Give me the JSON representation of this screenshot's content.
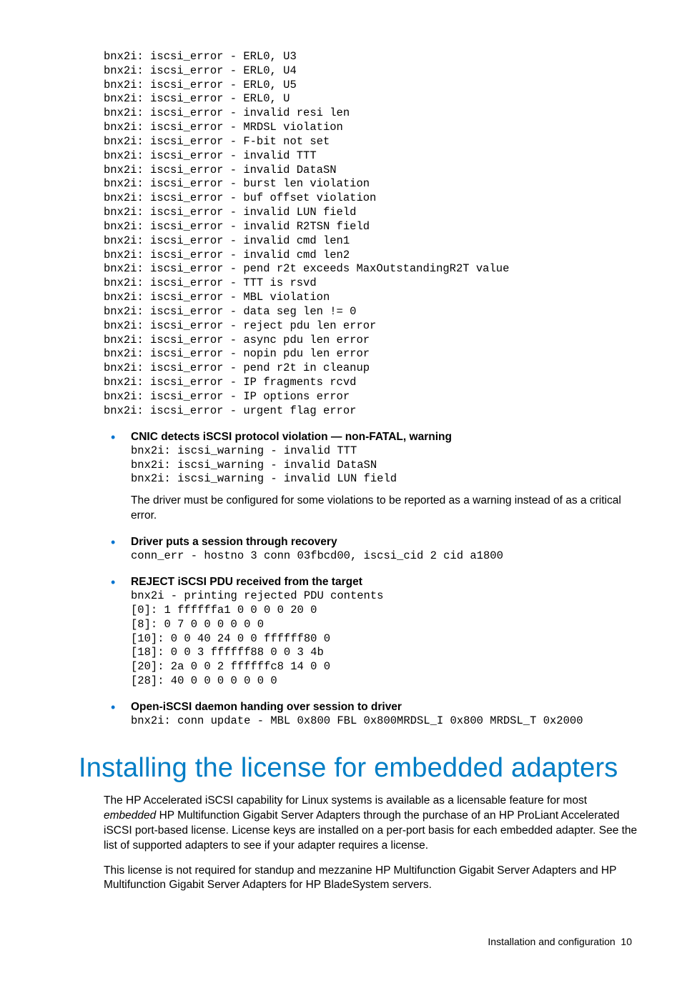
{
  "code_block_1": "bnx2i: iscsi_error - ERL0, U3\nbnx2i: iscsi_error - ERL0, U4\nbnx2i: iscsi_error - ERL0, U5\nbnx2i: iscsi_error - ERL0, U\nbnx2i: iscsi_error - invalid resi len\nbnx2i: iscsi_error - MRDSL violation\nbnx2i: iscsi_error - F-bit not set\nbnx2i: iscsi_error - invalid TTT\nbnx2i: iscsi_error - invalid DataSN\nbnx2i: iscsi_error - burst len violation\nbnx2i: iscsi_error - buf offset violation\nbnx2i: iscsi_error - invalid LUN field\nbnx2i: iscsi_error - invalid R2TSN field\nbnx2i: iscsi_error - invalid cmd len1\nbnx2i: iscsi_error - invalid cmd len2\nbnx2i: iscsi_error - pend r2t exceeds MaxOutstandingR2T value\nbnx2i: iscsi_error - TTT is rsvd\nbnx2i: iscsi_error - MBL violation\nbnx2i: iscsi_error - data seg len != 0\nbnx2i: iscsi_error - reject pdu len error\nbnx2i: iscsi_error - async pdu len error\nbnx2i: iscsi_error - nopin pdu len error\nbnx2i: iscsi_error - pend r2t in cleanup\nbnx2i: iscsi_error - IP fragments rcvd\nbnx2i: iscsi_error - IP options error\nbnx2i: iscsi_error - urgent flag error",
  "topics": [
    {
      "title": "CNIC detects iSCSI protocol violation — non-FATAL, warning",
      "code": "bnx2i: iscsi_warning - invalid TTT\nbnx2i: iscsi_warning - invalid DataSN\nbnx2i: iscsi_warning - invalid LUN field",
      "body": "The driver must be configured for some violations to be reported as a warning instead of as a critical error."
    },
    {
      "title": "Driver puts a session through recovery",
      "code": "conn_err - hostno 3 conn 03fbcd00, iscsi_cid 2 cid a1800",
      "body": ""
    },
    {
      "title": "REJECT iSCSI PDU received from the target",
      "code": "bnx2i - printing rejected PDU contents\n[0]: 1 ffffffa1 0 0 0 0 20 0\n[8]: 0 7 0 0 0 0 0 0\n[10]: 0 0 40 24 0 0 ffffff80 0\n[18]: 0 0 3 ffffff88 0 0 3 4b\n[20]: 2a 0 0 2 ffffffc8 14 0 0\n[28]: 40 0 0 0 0 0 0 0",
      "body": ""
    },
    {
      "title": "Open-iSCSI daemon handing over session to driver",
      "code": "bnx2i: conn update - MBL 0x800 FBL 0x800MRDSL_I 0x800 MRDSL_T 0x2000",
      "body": ""
    }
  ],
  "section_heading": "Installing the license for embedded adapters",
  "section_p1_a": "The HP Accelerated iSCSI capability for Linux systems is available as a licensable feature for most ",
  "section_p1_em": "embedded",
  "section_p1_b": " HP Multifunction Gigabit Server Adapters through the purchase of an HP ProLiant Accelerated iSCSI port-based license. License keys are installed on a per-port basis for each embedded adapter. See the list of supported adapters to see if your adapter requires a license.",
  "section_p2": "This license is not required for standup and mezzanine HP Multifunction Gigabit Server Adapters and HP Multifunction Gigabit Server Adapters for HP BladeSystem servers.",
  "footer_label": "Installation and configuration",
  "footer_page": "10"
}
